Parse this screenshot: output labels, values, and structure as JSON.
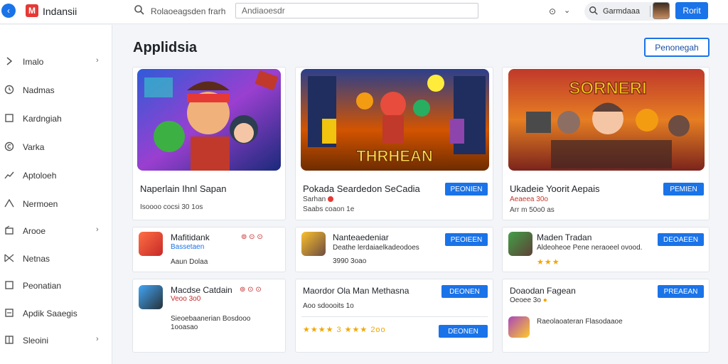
{
  "header": {
    "brand": "Indansii",
    "search_label": "Rolaoeagsden frarh",
    "search_value": "Andiaoesdr",
    "user_text": "Garmdaaa",
    "action_label": "Rorit"
  },
  "sidebar": {
    "items": [
      {
        "label": "Imalo",
        "chevron": "›"
      },
      {
        "label": "Nadmas",
        "chevron": ""
      },
      {
        "label": "Kardngiah",
        "chevron": ""
      },
      {
        "label": "Varka",
        "chevron": ""
      },
      {
        "label": "Aptoloeh",
        "chevron": ""
      },
      {
        "label": "Nermoen",
        "chevron": ""
      },
      {
        "label": "Arooe",
        "chevron": "›"
      },
      {
        "label": "Netnas",
        "chevron": ""
      },
      {
        "label": "Peonatian",
        "chevron": ""
      },
      {
        "label": "Apdik Saaegis",
        "chevron": ""
      },
      {
        "label": "Sleoini",
        "chevron": "›"
      }
    ]
  },
  "main": {
    "title": "Applidsia",
    "outline_button": "Penonegah",
    "featured": [
      {
        "title": "Naperlain Ihnl Sapan",
        "meta": "Isoooo cocsi 30 1os",
        "button": "",
        "banner_text": ""
      },
      {
        "title": "Pokada Seardedon SeCadia",
        "meta": "Sarhan",
        "meta2": "Saabs coaon 1e",
        "button": "PEONIEN",
        "banner_text": "THRHEAN"
      },
      {
        "title": "Ukadeie Yoorit Aepais",
        "meta": "Aeaeea 30o",
        "meta2": "Arr m 50o0 as",
        "button": "PEMIEN",
        "banner_text": "SORNERI"
      }
    ],
    "list": [
      {
        "title": "Mafitidank",
        "sub": "Bassetaen",
        "meta": "Aaun Dolaa",
        "button": ""
      },
      {
        "title": "Nanteaedeniar",
        "sub": "Deathe lerdaiaelkadeodoes",
        "meta": "3990 3oao",
        "button": "PEOIEEN"
      },
      {
        "title": "Maden Tradan",
        "sub": "Aldeoheoe Pene neraoeel ovood.",
        "meta": "★★★",
        "button": "DEOAEEN"
      },
      {
        "title": "Macdse Catdain",
        "sub": "Veoo 3o0",
        "meta": "Sieoebaanerian Bosdooo 1ooasao",
        "button": ""
      },
      {
        "title": "Maordor Ola Man Methasna",
        "sub": "Aoo sdoooits 1o",
        "meta": "★★★★ 3 ★★★ 2oo",
        "button": "DEONEN"
      },
      {
        "title": "Doaodan Fagean",
        "sub": "Oeoee 3o",
        "meta": "Raeolaoateran Flasodaaoe",
        "button": "PREAEAN"
      }
    ]
  },
  "colors": {
    "accent": "#1a73e8",
    "brand_red": "#e53935",
    "star": "#f2a600"
  }
}
